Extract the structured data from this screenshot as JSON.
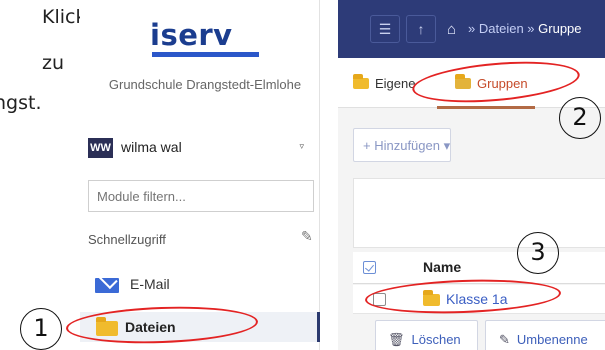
{
  "instructions": {
    "line1": "Klicke",
    "line2": "zu",
    "line3": "ngst."
  },
  "sidebar": {
    "logo": "iserv",
    "school_name": "Grundschule Drangstedt-Elmlohe",
    "user": {
      "initials": "WW",
      "name": "wilma wal",
      "caret": "▿"
    },
    "filter_placeholder": "Module filtern...",
    "quick_access_label": "Schnellzugriff",
    "quick_edit_icon": "✎",
    "items": [
      {
        "label": "E-Mail",
        "icon": "mail-icon"
      },
      {
        "label": "Dateien",
        "icon": "folder-icon",
        "active": true
      }
    ]
  },
  "topbar": {
    "menu_icon": "☰",
    "up_icon": "↑",
    "home_icon": "⌂",
    "breadcrumb_sep": "»",
    "breadcrumb_files": "Dateien",
    "breadcrumb_groups": "Gruppe"
  },
  "tabs": {
    "own": "Eigene",
    "groups": "Gruppen"
  },
  "toolbar": {
    "add_label": "+ Hinzufügen ▾"
  },
  "table": {
    "header_name": "Name",
    "rows": [
      {
        "name": "Klasse 1a"
      }
    ]
  },
  "actions": {
    "delete_icon": "🗑",
    "delete_label": "Löschen",
    "rename_icon": "✎",
    "rename_label": "Umbenenne"
  },
  "annotations": {
    "step1": "1",
    "step2": "2",
    "step3": "3",
    "color": "#e32323"
  },
  "colors": {
    "topbar": "#2d3b78",
    "logo": "#1b3d8f",
    "link": "#3a5ec4",
    "active_tab": "#c64b2a",
    "folder": "#f0bb2d"
  }
}
